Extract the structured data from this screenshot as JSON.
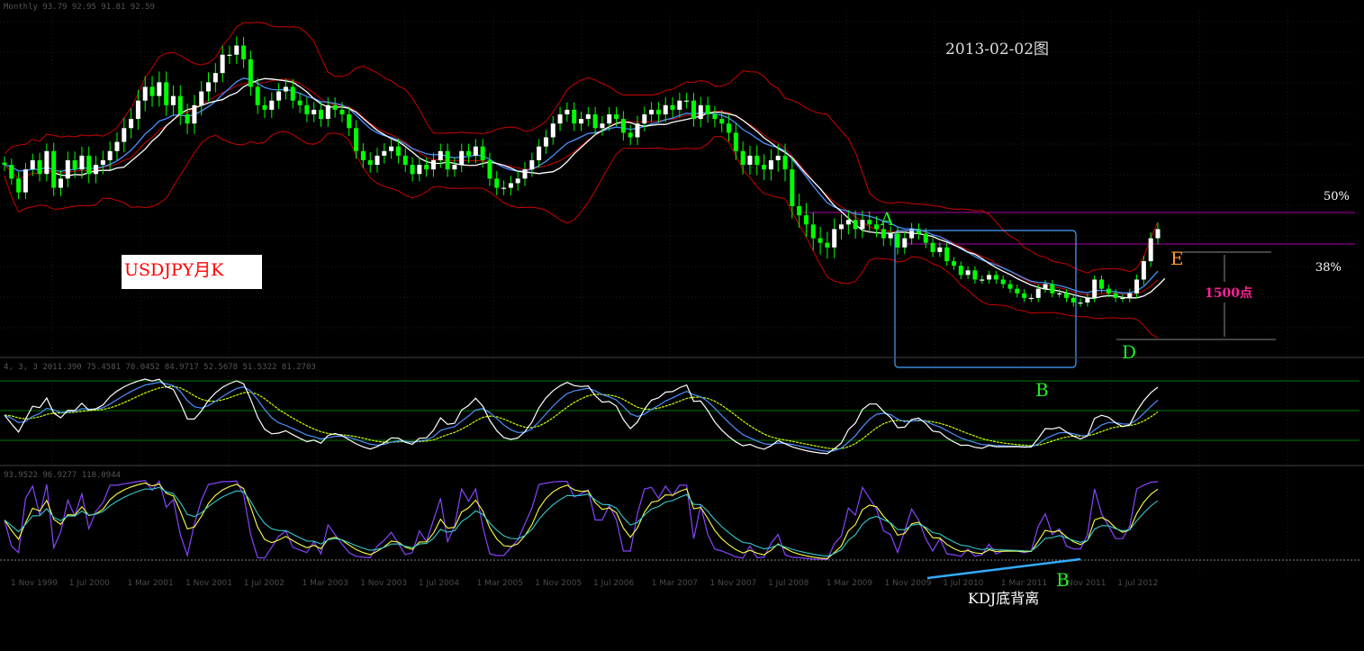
{
  "header": {
    "price_info": "Monthly  93.79 92.95 91.81 92.59",
    "kdj_info": "4, 3, 3 2011.390 75.4581 70.0452 84.9717 52.5678 51.5322 81.2703",
    "rsi_info": "93.9522 96.9277 118.0944"
  },
  "labels": {
    "title": "USDJPY月K",
    "date": "2013-02-02图",
    "point_A": "A",
    "point_B": "B",
    "point_D": "D",
    "point_E": "E",
    "point_B2": "B",
    "fib_50": "50%",
    "fib_38": "38%",
    "range_points": "1500点",
    "kdj_divergence": "KDJ底背离"
  },
  "colors": {
    "bull": "#ffffff",
    "bear": "#00ff00",
    "bollinger": "#cc0000",
    "ma_blue": "#4a90ff",
    "ma_white": "#ffffff",
    "fib_line": "#aa00aa",
    "box": "#4aa0ff",
    "grid": "#1e1e1e",
    "kdj_k": "#ffffff",
    "kdj_d": "#4a90ff",
    "kdj_j": "#ccff00",
    "rsi_purple": "#8844ff",
    "rsi_yellow": "#ffff44",
    "rsi_cyan": "#33cccc"
  },
  "chart_data": {
    "type": "candlestick",
    "symbol": "USDJPY",
    "timeframe": "monthly",
    "x_ticks": [
      "1 Nov 1999",
      "1 Jul 2000",
      "1 Mar 2001",
      "1 Nov 2001",
      "1 Jul 2002",
      "1 Mar 2003",
      "1 Nov 2003",
      "1 Jul 2004",
      "1 Mar 2005",
      "1 Nov 2005",
      "1 Jul 2006",
      "1 Mar 2007",
      "1 Nov 2007",
      "1 Jul 2008",
      "1 Mar 2009",
      "1 Nov 2009",
      "1 Jul 2010",
      "1 Mar 2011",
      "1 Nov 2011",
      "1 Jul 2012"
    ],
    "close": [
      107,
      104,
      101,
      106,
      108,
      105,
      110,
      102,
      104,
      108,
      106,
      109,
      105,
      107,
      108,
      110,
      112,
      115,
      117,
      121,
      124,
      122,
      125,
      120,
      122,
      118,
      116,
      120,
      123,
      125,
      127,
      131,
      131,
      133,
      130,
      124,
      120,
      119,
      121,
      123,
      124,
      121,
      120,
      118,
      119,
      117,
      120,
      119,
      118,
      115,
      110,
      108,
      107,
      109,
      110,
      111,
      109,
      107,
      105,
      107,
      106,
      108,
      110,
      106,
      107,
      110,
      109,
      111,
      108,
      104,
      102,
      102,
      103,
      104,
      106,
      108,
      111,
      113,
      116,
      118,
      119,
      116,
      117,
      118,
      115,
      116,
      118,
      117,
      114,
      113,
      116,
      118,
      119,
      118,
      120,
      119,
      121,
      121,
      117,
      120,
      118,
      117,
      116,
      114,
      110,
      107,
      109,
      107,
      106,
      108,
      109,
      106,
      98,
      96,
      94,
      91,
      90,
      89,
      93,
      94,
      95,
      93,
      95,
      94,
      93,
      91,
      92,
      89,
      91,
      93,
      92,
      90,
      88,
      89,
      86,
      85,
      83,
      84,
      82,
      82,
      83,
      82,
      81,
      80,
      79,
      78,
      78,
      80,
      81,
      79,
      79,
      78,
      77,
      77,
      78,
      82,
      80,
      79,
      78,
      78,
      79,
      82,
      86,
      91,
      93
    ],
    "volatility": [
      1.5,
      1.5,
      1.6,
      1.6,
      1.6,
      1.8,
      1.8,
      2.0,
      2.0,
      2.1,
      2.1,
      2.2,
      2.2,
      2.2,
      2.3,
      2.3,
      2.3,
      2.5,
      2.5,
      2.6,
      2.6,
      2.6,
      2.6,
      2.6,
      2.6,
      2.6,
      2.6,
      2.5,
      2.5,
      2.4,
      2.4,
      2.2,
      2.2,
      2.2,
      2.1,
      2.1,
      2.1,
      2.0,
      2.0,
      2.0,
      2.0,
      1.9,
      1.9,
      1.9,
      1.9,
      1.9,
      1.9,
      1.9,
      1.9,
      1.9,
      1.9,
      1.9,
      1.9,
      1.9,
      1.9,
      1.9,
      1.9,
      1.8,
      1.8,
      1.8,
      1.8,
      1.8,
      1.8,
      1.8,
      1.8,
      1.8,
      1.8,
      1.8,
      1.8,
      1.8,
      1.8,
      1.8,
      1.8,
      1.8,
      1.8,
      1.8,
      1.8,
      1.8,
      1.8,
      1.8,
      1.8,
      1.8,
      1.8,
      1.8,
      1.8,
      1.8,
      1.8,
      1.8,
      1.9,
      1.9,
      1.9,
      1.9,
      1.9,
      1.9,
      1.9,
      1.9,
      1.9,
      1.9,
      1.9,
      2.0,
      2.0,
      2.0,
      2.1,
      2.1,
      2.2,
      2.3,
      2.4,
      2.5,
      2.6,
      2.7,
      2.8,
      2.9,
      3.0,
      3.0,
      3.0,
      2.9,
      2.8,
      2.7,
      2.6,
      2.5,
      2.4,
      2.3,
      2.2,
      2.1,
      2.0,
      1.9,
      1.8,
      1.7,
      1.6,
      1.5,
      1.4,
      1.3,
      1.2,
      1.2,
      1.1,
      1.0,
      1.0,
      1.0,
      1.0,
      1.0,
      1.0,
      1.0,
      1.0,
      1.0,
      1.0,
      1.0,
      1.0,
      1.0,
      1.0,
      1.0,
      1.0,
      1.0,
      1.0,
      1.0,
      1.0,
      1.0,
      1.0,
      1.0,
      1.0,
      1.0,
      1.1,
      1.2,
      1.3,
      1.4,
      1.5
    ]
  }
}
